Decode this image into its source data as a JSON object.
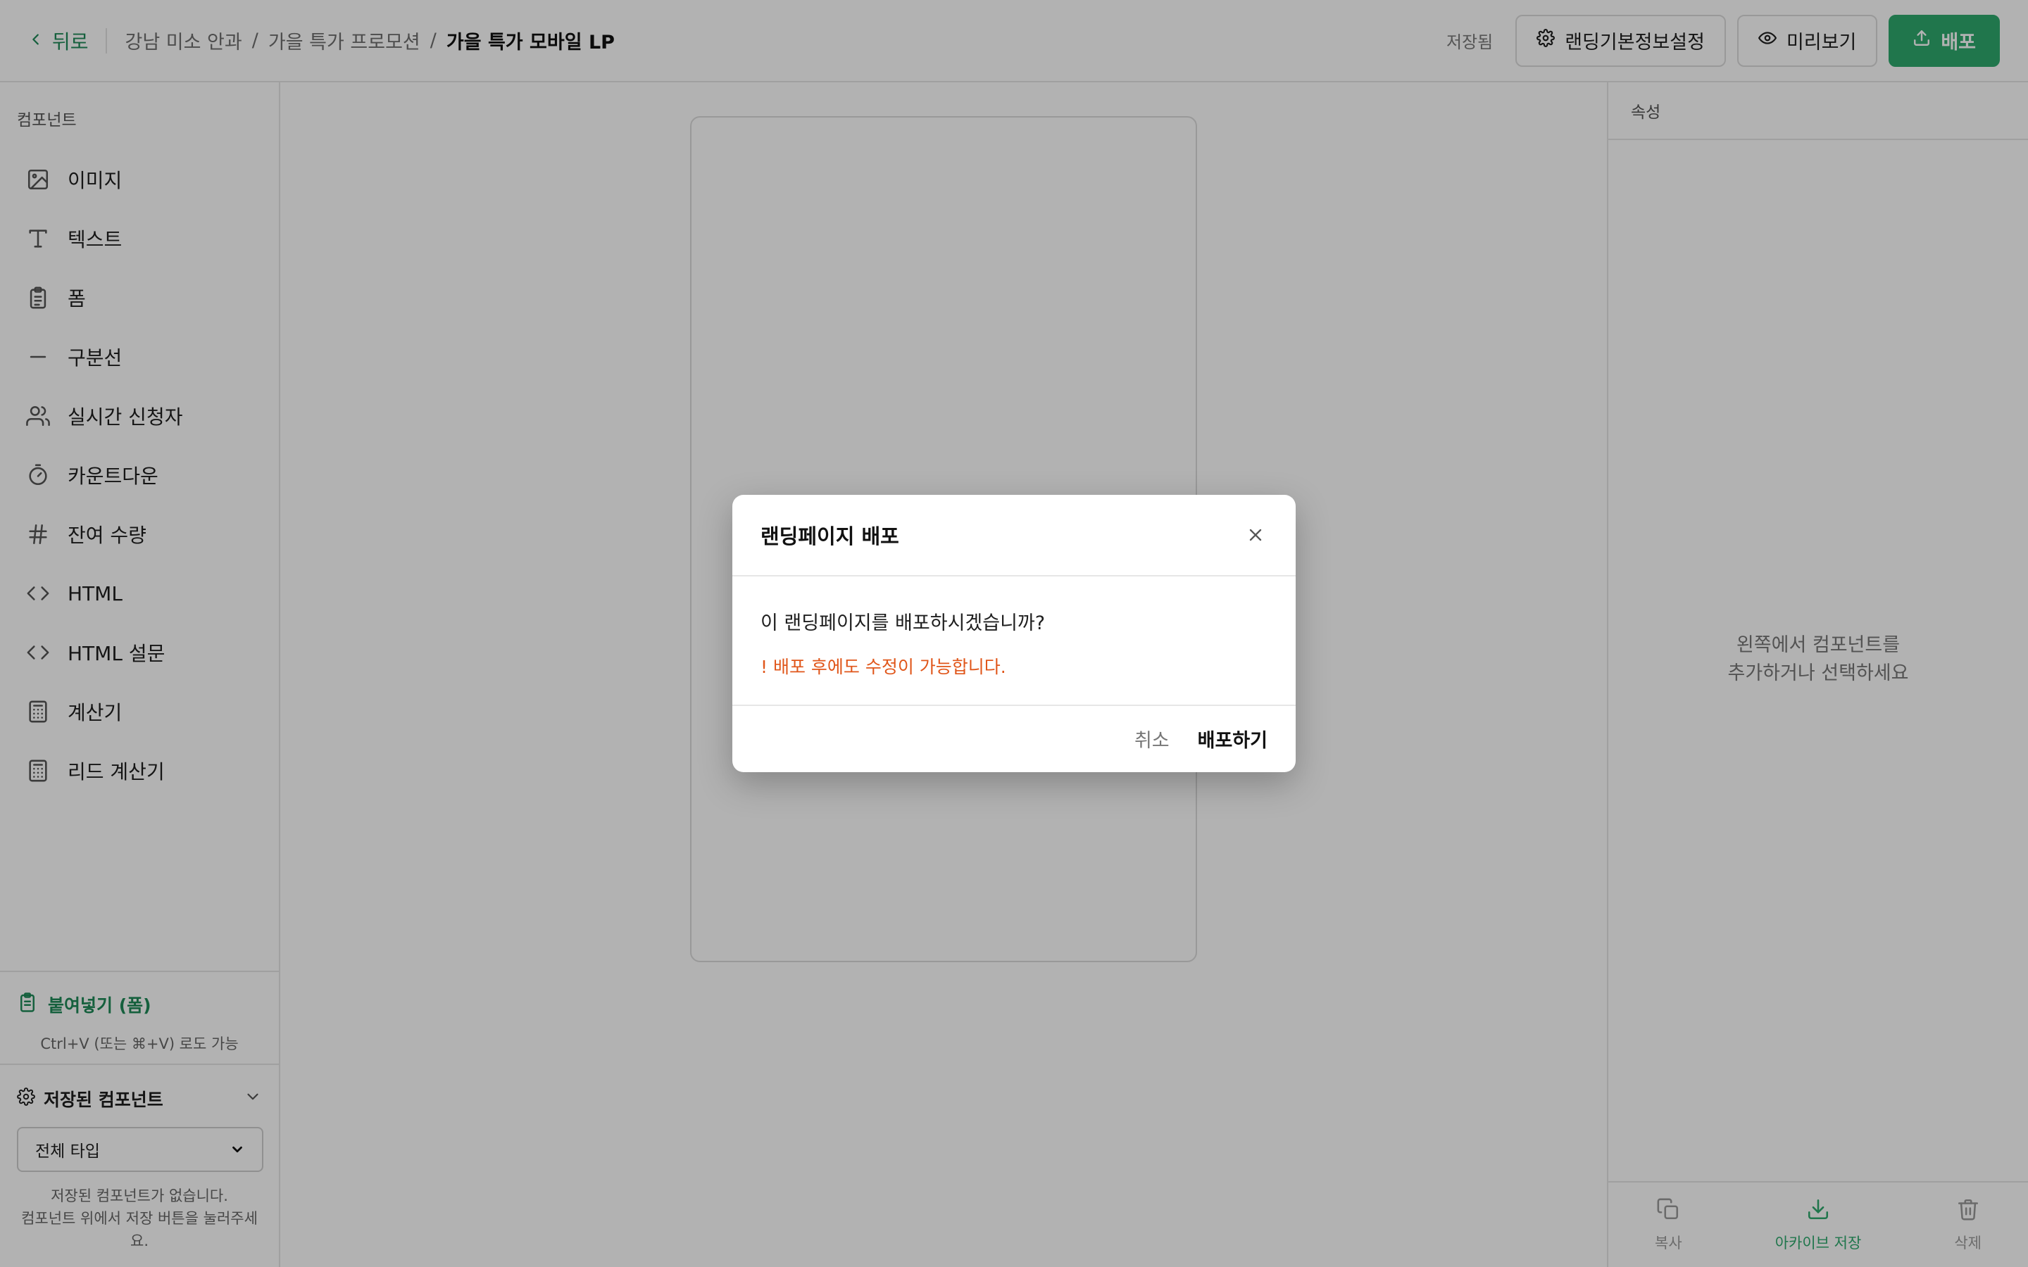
{
  "header": {
    "back_label": "뒤로",
    "breadcrumb": [
      "강남 미소 안과",
      "가을 특가 프로모션",
      "가을 특가 모바일 LP"
    ],
    "separator": "/",
    "saved_status": "저장됨",
    "settings_label": "랜딩기본정보설정",
    "preview_label": "미리보기",
    "deploy_label": "배포"
  },
  "sidebar": {
    "title": "컴포넌트",
    "items": [
      {
        "label": "이미지",
        "icon": "image-icon"
      },
      {
        "label": "텍스트",
        "icon": "text-icon"
      },
      {
        "label": "폼",
        "icon": "clipboard-icon"
      },
      {
        "label": "구분선",
        "icon": "divider-icon"
      },
      {
        "label": "실시간 신청자",
        "icon": "users-icon"
      },
      {
        "label": "카운트다운",
        "icon": "timer-icon"
      },
      {
        "label": "잔여 수량",
        "icon": "hash-icon"
      },
      {
        "label": "HTML",
        "icon": "code-icon"
      },
      {
        "label": "HTML 설문",
        "icon": "code-icon"
      },
      {
        "label": "계산기",
        "icon": "calculator-icon"
      },
      {
        "label": "리드 계산기",
        "icon": "calculator-icon"
      }
    ],
    "paste": {
      "title": "붙여넣기 (폼)",
      "hint": "Ctrl+V (또는 ⌘+V) 로도 가능"
    },
    "saved_components": {
      "title": "저장된 컴포넌트",
      "select_value": "전체 타입",
      "empty_line1": "저장된 컴포넌트가 없습니다.",
      "empty_line2": "컴포넌트 위에서 저장 버튼을 눌러주세요."
    }
  },
  "right_panel": {
    "title": "속성",
    "empty_line1": "왼쪽에서 컴포넌트를",
    "empty_line2": "추가하거나 선택하세요",
    "actions": {
      "copy": "복사",
      "archive": "아카이브 저장",
      "delete": "삭제"
    }
  },
  "modal": {
    "title": "랜딩페이지 배포",
    "question": "이 랜딩페이지를 배포하시겠습니까?",
    "warning": "! 배포 후에도 수정이 가능합니다.",
    "cancel": "취소",
    "confirm": "배포하기"
  },
  "colors": {
    "accent": "#2eaa6e",
    "warning": "#e0561a",
    "overlay": "rgba(0,0,0,0.30)"
  }
}
